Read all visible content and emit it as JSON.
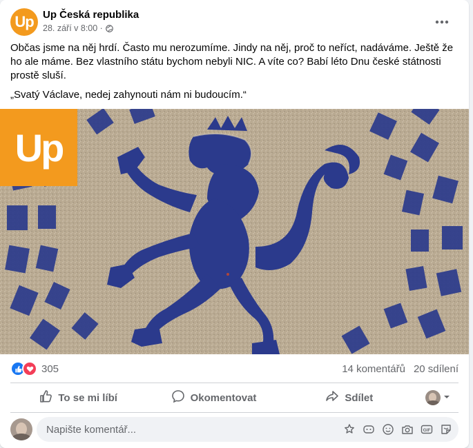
{
  "post": {
    "page_avatar_text": "Up",
    "page_name": "Up Česká republika",
    "timestamp": "28. září v 8:00 ·",
    "paragraph1": "Občas jsme na něj hrdí. Často mu nerozumíme. Jindy na něj, proč to neříct, nadáváme. Ještě že ho ale máme. Bez vlastního státu bychom nebyli NIC. A víte co? Babí léto Dnu české státnosti prostě sluší.",
    "paragraph2": "„Svatý Václave, nedej zahynouti nám ni budoucím.“",
    "image_logo_text": "Up"
  },
  "stats": {
    "reaction_count": "305",
    "comments": "14 komentářů",
    "shares": "20 sdílení"
  },
  "actions": {
    "like": "To se mi líbí",
    "comment": "Okomentovat",
    "share": "Sdílet"
  },
  "comment_input": {
    "placeholder": "Napište komentář..."
  },
  "colors": {
    "brand_orange": "#f39a1e",
    "facebook_blue": "#1877f2",
    "love_red": "#f33e58",
    "emblem_blue": "#2b3a8c"
  },
  "icons": [
    "globe-icon",
    "more-options-icon",
    "like-reaction-icon",
    "love-reaction-icon",
    "thumbs-up-icon",
    "comment-bubble-icon",
    "share-arrow-icon",
    "chevron-down-icon",
    "avatar-sticker-icon",
    "sticker-icon",
    "emoji-icon",
    "camera-icon",
    "gif-icon",
    "sticker-note-icon"
  ]
}
